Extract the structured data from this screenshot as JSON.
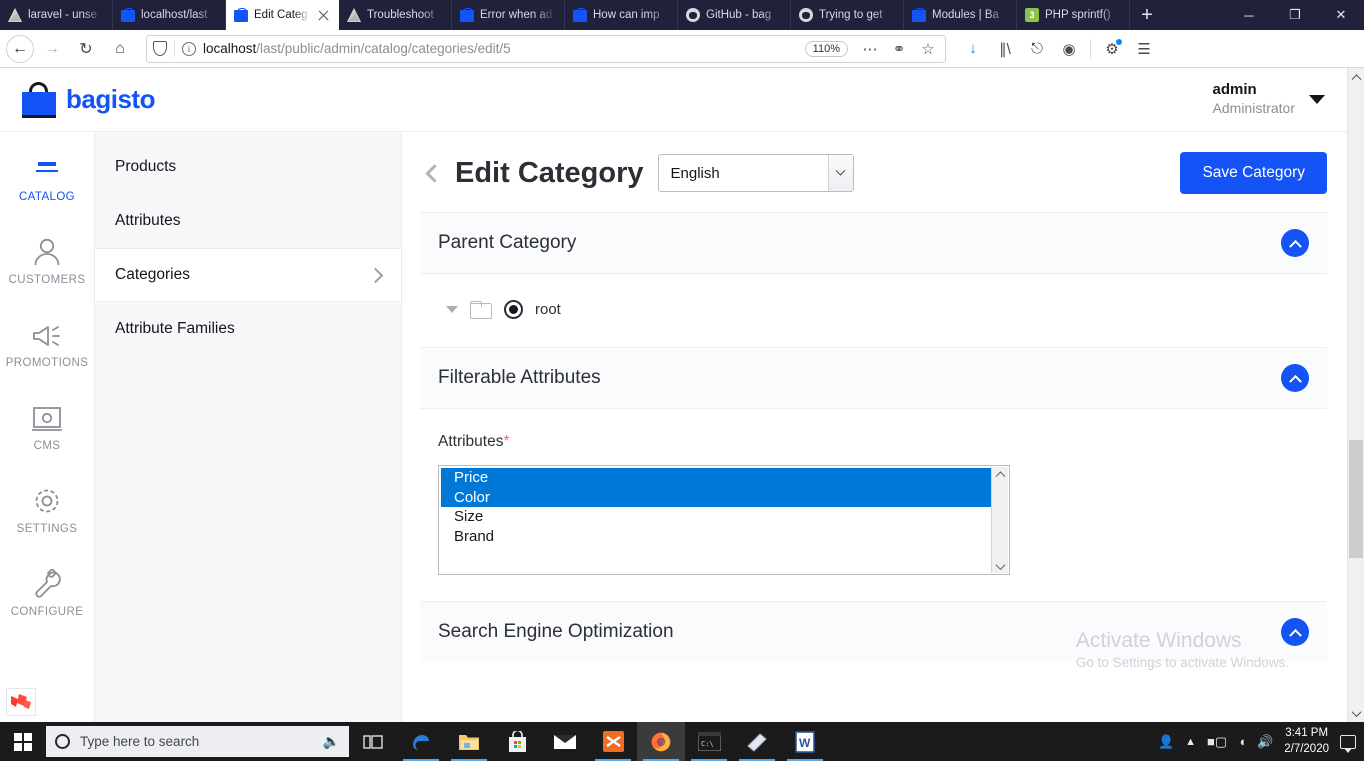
{
  "browser": {
    "tabs": [
      {
        "title": "laravel - unse",
        "favicon": "laravel-icon",
        "active": false,
        "closable": false
      },
      {
        "title": "localhost/last",
        "favicon": "bagisto-icon",
        "active": false,
        "closable": false
      },
      {
        "title": "Edit Categ",
        "favicon": "bagisto-icon",
        "active": true,
        "closable": true
      },
      {
        "title": "Troubleshoot",
        "favicon": "laravel-icon",
        "active": false,
        "closable": false
      },
      {
        "title": "Error when ad",
        "favicon": "bagisto-icon",
        "active": false,
        "closable": false
      },
      {
        "title": "How can imp",
        "favicon": "bagisto-icon",
        "active": false,
        "closable": false
      },
      {
        "title": "GitHub - bag",
        "favicon": "github-icon",
        "active": false,
        "closable": false
      },
      {
        "title": "Trying to get",
        "favicon": "github-icon",
        "active": false,
        "closable": false
      },
      {
        "title": "Modules | Ba",
        "favicon": "bagisto-icon",
        "active": false,
        "closable": false
      },
      {
        "title": "PHP sprintf()",
        "favicon": "php-icon",
        "active": false,
        "closable": false
      }
    ],
    "new_tab_label": "+",
    "window_controls": {
      "minimize": "─",
      "maximize": "❐",
      "close": "✕"
    },
    "url_prefix": "localhost",
    "url_path": "/last/public/admin/catalog/categories/edit/5",
    "zoom_level": "110%"
  },
  "header": {
    "logo_text": "bagisto",
    "username": "admin",
    "role": "Administrator"
  },
  "rail_nav": {
    "items": [
      {
        "label": "CATALOG",
        "icon": "catalog-icon",
        "active": true
      },
      {
        "label": "CUSTOMERS",
        "icon": "customers-icon",
        "active": false
      },
      {
        "label": "PROMOTIONS",
        "icon": "promotions-icon",
        "active": false
      },
      {
        "label": "CMS",
        "icon": "cms-icon",
        "active": false
      },
      {
        "label": "SETTINGS",
        "icon": "settings-icon",
        "active": false
      },
      {
        "label": "CONFIGURE",
        "icon": "configure-icon",
        "active": false
      }
    ]
  },
  "sub_nav": {
    "items": [
      {
        "label": "Products",
        "active": false
      },
      {
        "label": "Attributes",
        "active": false
      },
      {
        "label": "Categories",
        "active": true
      },
      {
        "label": "Attribute Families",
        "active": false
      }
    ]
  },
  "main": {
    "title": "Edit Category",
    "language_selected": "English",
    "save_label": "Save Category",
    "panels": [
      {
        "title": "Parent Category"
      },
      {
        "title": "Filterable Attributes"
      },
      {
        "title": "Search Engine Optimization"
      }
    ],
    "parent_category": {
      "tree_node_label": "root",
      "selected": true
    },
    "attributes_field": {
      "label": "Attributes",
      "required_marker": "*",
      "options": [
        {
          "label": "Price",
          "selected": true
        },
        {
          "label": "Color",
          "selected": true
        },
        {
          "label": "Size",
          "selected": false
        },
        {
          "label": "Brand",
          "selected": false
        }
      ]
    }
  },
  "watermark": {
    "title": "Activate Windows",
    "subtitle": "Go to Settings to activate Windows."
  },
  "taskbar": {
    "search_placeholder": "Type here to search",
    "apps": [
      {
        "name": "task-view",
        "running": false
      },
      {
        "name": "edge",
        "running": true
      },
      {
        "name": "file-explorer",
        "running": true
      },
      {
        "name": "microsoft-store",
        "running": false
      },
      {
        "name": "mail",
        "running": false
      },
      {
        "name": "xampp",
        "running": true
      },
      {
        "name": "firefox",
        "running": true,
        "active": true
      },
      {
        "name": "command-prompt",
        "running": true
      },
      {
        "name": "sticky-notes",
        "running": true
      },
      {
        "name": "word",
        "running": true
      }
    ],
    "time": "3:41 PM",
    "date": "2/7/2020"
  },
  "colors": {
    "brand_blue": "#1453f5",
    "select_blue": "#0078d7",
    "required_red": "#f4706b",
    "chrome_dark": "#20223b"
  }
}
